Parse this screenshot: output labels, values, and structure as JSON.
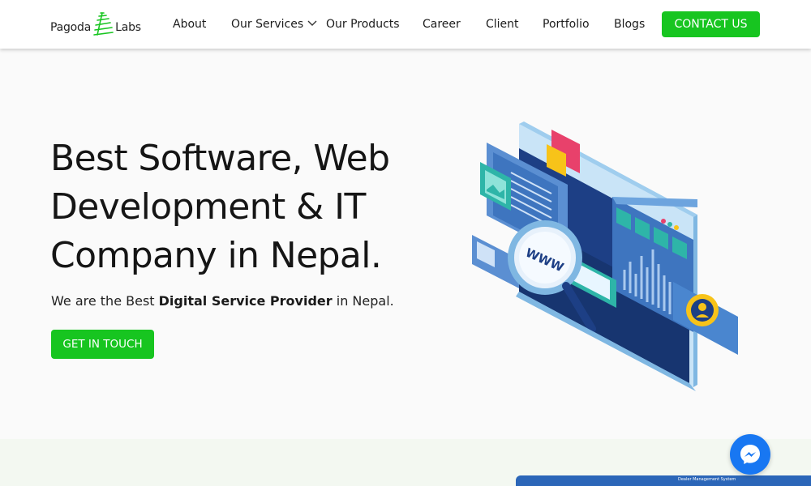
{
  "logo": {
    "word1": "Pagoda",
    "word2": "Labs",
    "brand_color": "#17c520"
  },
  "nav": {
    "items": [
      {
        "label": "About"
      },
      {
        "label": "Our Services",
        "has_dropdown": true
      },
      {
        "label": "Our Products"
      },
      {
        "label": "Career"
      },
      {
        "label": "Client"
      },
      {
        "label": "Portfolio"
      },
      {
        "label": "Blogs"
      }
    ],
    "contact_label": "CONTACT US"
  },
  "hero": {
    "title_line1": "Best Software, Web",
    "title_line2": "Development & IT",
    "title_line3": "Company in Nepal.",
    "sub_prefix": "We are the Best ",
    "sub_bold": "Digital Service Provider",
    "sub_suffix": " in Nepal.",
    "cta_label": "GET IN TOUCH"
  },
  "illustration": {
    "search_text": "WWW"
  },
  "preview": {
    "title": "Dealer Management System"
  },
  "colors": {
    "accent": "#17c520",
    "messenger": "#1877f2"
  }
}
